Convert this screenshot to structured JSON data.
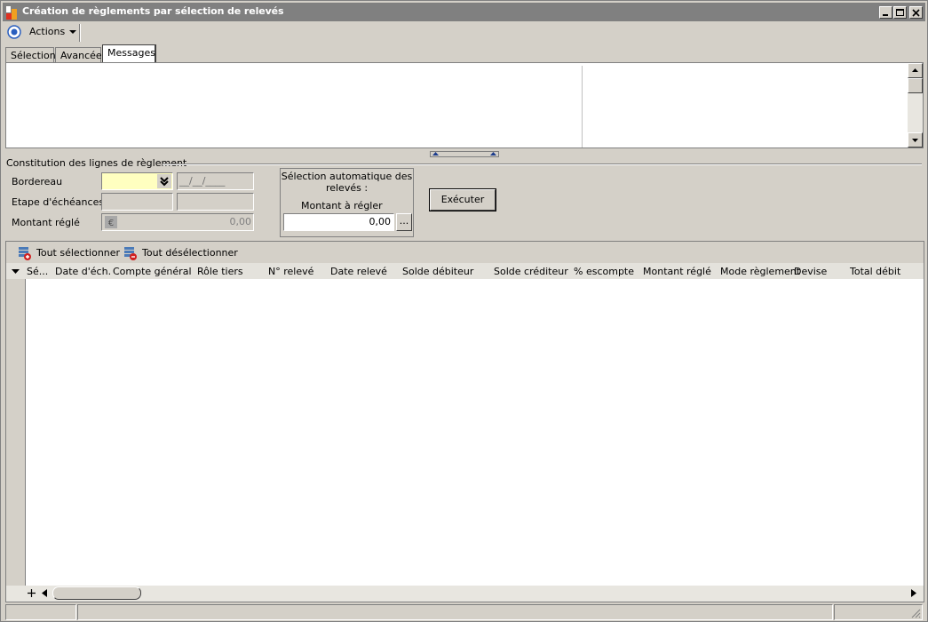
{
  "window": {
    "title": "Création de règlements par sélection de relevés",
    "colors": {
      "titlebar": "#808080",
      "chrome": "#d4d0c8",
      "highlight_field": "#ffffc0"
    }
  },
  "toolbar": {
    "actions_label": "Actions"
  },
  "tabs": [
    {
      "label": "Sélection",
      "active": false
    },
    {
      "label": "Avancée",
      "active": false
    },
    {
      "label": "Messages",
      "active": true
    }
  ],
  "group": {
    "title": "Constitution des lignes de règlement",
    "bordereau_label": "Bordereau",
    "bordereau_date_placeholder": "__/__/____",
    "etape_label": "Etape d'échéances",
    "montant_label": "Montant réglé",
    "montant_currency_icon": "euro-icon",
    "montant_value": "0,00"
  },
  "auto_selection": {
    "title_line1": "Sélection automatique des",
    "title_line2": "relevés :",
    "montant_label": "Montant à régler",
    "montant_value": "0,00",
    "browse_label": "..."
  },
  "execute_button": {
    "label": "Exécuter"
  },
  "grid": {
    "select_all_label": "Tout sélectionner",
    "deselect_all_label": "Tout désélectionner",
    "columns": [
      "Sé...",
      "Date d'éch.",
      "Compte général",
      "Rôle tiers",
      "N° relevé",
      "Date relevé",
      "Solde débiteur",
      "Solde créditeur",
      "% escompte",
      "Montant réglé",
      "Mode règlement",
      "Devise",
      "Total débit"
    ],
    "rows": []
  }
}
